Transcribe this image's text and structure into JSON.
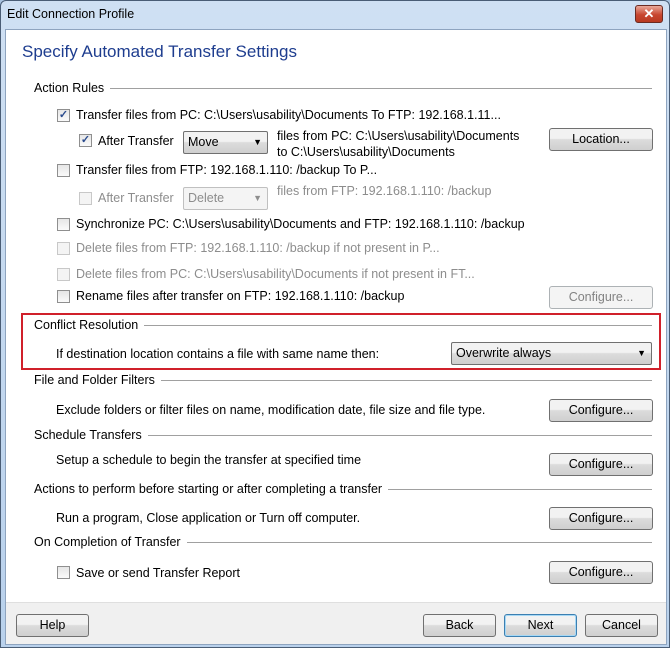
{
  "window": {
    "title": "Edit Connection Profile",
    "close_icon": "close-icon"
  },
  "heading": "Specify Automated Transfer Settings",
  "action_rules": {
    "title": "Action Rules",
    "transfer_pc_to_ftp": {
      "label": "Transfer files from PC: C:\\Users\\usability\\Documents  To  FTP: 192.168.1.11...",
      "checked": true
    },
    "after_transfer_1": {
      "label": "After Transfer",
      "checked": true,
      "select": "Move",
      "desc1": "files from PC: C:\\Users\\usability\\Documents",
      "desc2": "to C:\\Users\\usability\\Documents",
      "button": "Location..."
    },
    "transfer_ftp_to_pc": {
      "label": "Transfer files from FTP: 192.168.1.110: /backup  To  P...",
      "checked": false
    },
    "after_transfer_2": {
      "label": "After Transfer",
      "checked": false,
      "select": "Delete",
      "desc1": "files from FTP: 192.168.1.110: /backup"
    },
    "synchronize": {
      "label": "Synchronize PC: C:\\Users\\usability\\Documents and FTP: 192.168.1.110: /backup",
      "checked": false
    },
    "delete_ftp": {
      "label": "Delete files from FTP: 192.168.1.110: /backup if not present in P...",
      "checked": false
    },
    "delete_pc": {
      "label": "Delete files from PC: C:\\Users\\usability\\Documents if not present in FT...",
      "checked": false
    },
    "rename": {
      "label": "Rename files after transfer on FTP: 192.168.1.110: /backup",
      "checked": false,
      "button": "Configure..."
    }
  },
  "conflict": {
    "title": "Conflict Resolution",
    "label": "If destination location contains a file with same name then:",
    "select": "Overwrite always",
    "highlight_color": "#d0202a"
  },
  "filters": {
    "title": "File and Folder Filters",
    "desc": "Exclude folders or filter files on name, modification date, file size and file type.",
    "button": "Configure..."
  },
  "schedule": {
    "title": "Schedule Transfers",
    "desc": "Setup a schedule to begin the transfer at specified time",
    "button": "Configure..."
  },
  "actions": {
    "title": "Actions to perform before starting or after completing a transfer",
    "desc": "Run a program, Close application or Turn off computer.",
    "button": "Configure..."
  },
  "completion": {
    "title": "On Completion of Transfer",
    "label": "Save or send Transfer Report",
    "checked": false,
    "button": "Configure..."
  },
  "footer": {
    "help": "Help",
    "back": "Back",
    "next": "Next",
    "cancel": "Cancel"
  }
}
